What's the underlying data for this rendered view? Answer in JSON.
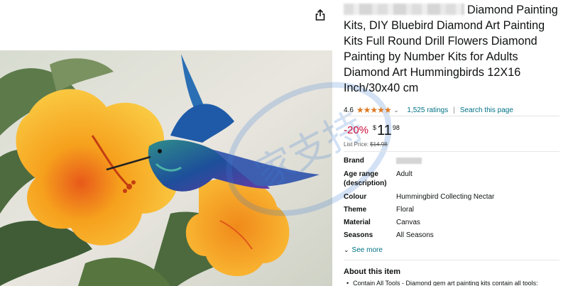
{
  "product": {
    "title_visible": "Diamond Painting Kits, DIY Bluebird Diamond Art Painting Kits Full Round Drill Flowers Diamond Painting by Number Kits for Adults Diamond Art Hummingbirds 12X16 Inch/30x40 cm",
    "image_alt": "Hummingbird and yellow hibiscus flowers painting"
  },
  "rating": {
    "value": "4.6",
    "stars": "★★★★★",
    "count_label": "1,525 ratings",
    "separator": "|",
    "search_link": "Search this page"
  },
  "price": {
    "discount": "-20%",
    "currency": "$",
    "whole": "11",
    "fraction": "98",
    "list_label": "List Price:",
    "list_value": "$14.98"
  },
  "specs": [
    {
      "key": "Brand",
      "value": ""
    },
    {
      "key": "Age range (description)",
      "value": "Adult"
    },
    {
      "key": "Colour",
      "value": "Hummingbird Collecting Nectar"
    },
    {
      "key": "Theme",
      "value": "Floral"
    },
    {
      "key": "Material",
      "value": "Canvas"
    },
    {
      "key": "Seasons",
      "value": "All Seasons"
    }
  ],
  "see_more": "See more",
  "about": {
    "heading": "About this item",
    "bullet_1": "Contain All Tools - Diamond gem art painting kits contain all tools:"
  },
  "watermark_text": "家支持",
  "icons": {
    "share": "share-icon",
    "chevron": "chevron-down-icon"
  },
  "colors": {
    "link": "#007185",
    "discount": "#cc0c39",
    "star": "#de7921"
  }
}
